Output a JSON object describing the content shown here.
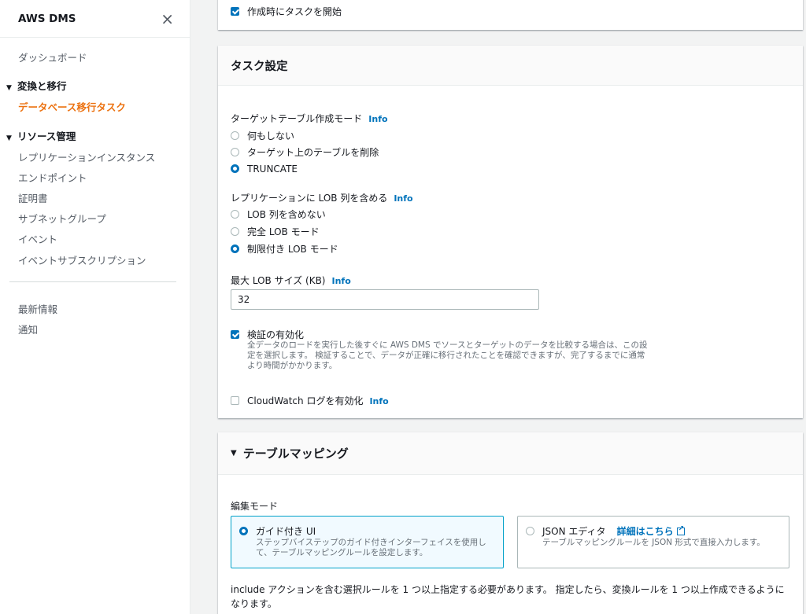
{
  "sidebar": {
    "title": "AWS DMS",
    "close_icon": "×",
    "dashboard": "ダッシュボード",
    "section1": "変換と移行",
    "section1_item": "データベース移行タスク",
    "section2": "リソース管理",
    "items": [
      "レプリケーションインスタンス",
      "エンドポイント",
      "証明書",
      "サブネットグループ",
      "イベント",
      "イベントサブスクリプション"
    ],
    "whats_new": "最新情報",
    "notifications": "通知"
  },
  "top_card": {
    "start_on_create": "作成時にタスクを開始"
  },
  "task_settings": {
    "title": "タスク設定",
    "info": "Info",
    "target_mode_label": "ターゲットテーブル作成モード",
    "target_modes": [
      "何もしない",
      "ターゲット上のテーブルを削除",
      "TRUNCATE"
    ],
    "lob_label": "レプリケーションに LOB 列を含める",
    "lob_modes": [
      "LOB 列を含めない",
      "完全 LOB モード",
      "制限付き LOB モード"
    ],
    "max_lob_label": "最大 LOB サイズ (KB)",
    "max_lob_value": "32",
    "validation_label": "検証の有効化",
    "validation_desc": "全データのロードを実行した後すぐに AWS DMS でソースとターゲットのデータを比較する場合は、この設定を選択します。 検証することで、データが正確に移行されたことを確認できますが、完了するまでに通常より時間がかかります。",
    "cloudwatch_label": "CloudWatch ログを有効化"
  },
  "table_mapping": {
    "title": "テーブルマッピング",
    "edit_mode_label": "編集モード",
    "guided_title": "ガイド付き UI",
    "guided_desc": "ステップバイステップのガイド付きインターフェイスを使用して、テーブルマッピングルールを設定します。",
    "json_title": "JSON エディタ",
    "json_link": "詳細はこちら",
    "json_desc": "テーブルマッピングルールを JSON 形式で直接入力します。",
    "note": "include アクションを含む選択ルールを 1 つ以上指定する必要があります。 指定したら、変換ルールを 1 つ以上作成できるようになります。"
  },
  "colors": {
    "accent": "#0073bb",
    "active_nav": "#ec7211"
  },
  "icons": {
    "close": "close-icon",
    "check": "check-icon",
    "external": "external-link-icon",
    "caret": "caret-down-icon"
  }
}
